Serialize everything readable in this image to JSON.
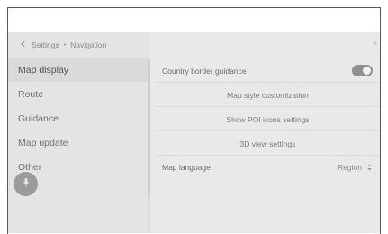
{
  "header": {
    "back_icon": "chevron-left-icon",
    "breadcrumb_parent": "Settings",
    "breadcrumb_separator": "•",
    "breadcrumb_current": "Navigation"
  },
  "sidebar": {
    "items": [
      {
        "label": "Map display",
        "active": true
      },
      {
        "label": "Route",
        "active": false
      },
      {
        "label": "Guidance",
        "active": false
      },
      {
        "label": "Map update",
        "active": false
      },
      {
        "label": "Other",
        "active": false
      }
    ],
    "mic_icon": "microphone-icon"
  },
  "content": {
    "country_border": {
      "label": "Country border guidance",
      "toggle_on": true
    },
    "map_style": {
      "label": "Map style customization"
    },
    "poi_icons": {
      "label": "Show POI icons settings"
    },
    "view_3d": {
      "label": "3D view settings"
    },
    "map_language": {
      "label": "Map language",
      "value": "Region",
      "arrows": "▲▼"
    }
  },
  "colors": {
    "screen_bg": "#e6e7e6",
    "sidebar_active": "#d9dad9",
    "toggle_on": "#8f908f",
    "mic_button": "#9a9b9a"
  }
}
